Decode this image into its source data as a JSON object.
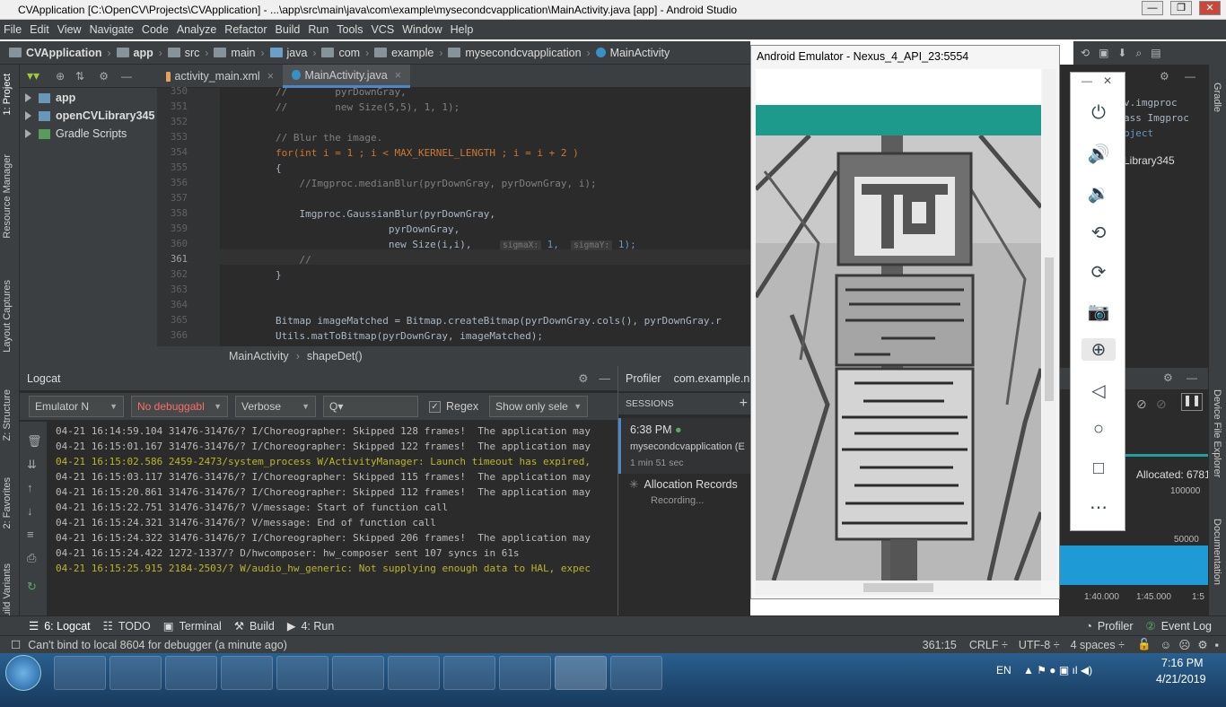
{
  "window": {
    "title": "CVApplication [C:\\OpenCV\\Projects\\CVApplication] - ...\\app\\src\\main\\java\\com\\example\\mysecondcvapplication\\MainActivity.java [app] - Android Studio",
    "min": "—",
    "max": "❐",
    "close": "✕"
  },
  "menu": [
    "File",
    "Edit",
    "View",
    "Navigate",
    "Code",
    "Analyze",
    "Refactor",
    "Build",
    "Run",
    "Tools",
    "VCS",
    "Window",
    "Help"
  ],
  "breadcrumb": [
    "CVApplication",
    "app",
    "src",
    "main",
    "java",
    "com",
    "example",
    "mysecondcvapplication",
    "MainActivity"
  ],
  "left_tabs": [
    "1: Project",
    "Resource Manager",
    "Layout Captures",
    "Z: Structure",
    "2: Favorites",
    "Build Variants"
  ],
  "project": {
    "items": [
      "app",
      "openCVLibrary345",
      "Gradle Scripts"
    ]
  },
  "editor": {
    "tabs": [
      "activity_main.xml",
      "MainActivity.java"
    ],
    "line_numbers": [
      "350",
      "351",
      "352",
      "353",
      "354",
      "355",
      "356",
      "357",
      "358",
      "359",
      "360",
      "361",
      "362",
      "363",
      "364",
      "365",
      "366"
    ],
    "lines": [
      "//        pyrDownGray,",
      "//        new Size(5,5), 1, 1);",
      "",
      "// Blur the image.",
      "for(int i = 1 ; i < MAX_KERNEL_LENGTH ; i = i + 2 )",
      "{",
      "    //Imgproc.medianBlur(pyrDownGray, pyrDownGray, i);",
      "",
      "    Imgproc.GaussianBlur(pyrDownGray,",
      "                   pyrDownGray,",
      "                   new Size(i,i),",
      "    //",
      "}",
      "",
      "",
      "Bitmap imageMatched = Bitmap.createBitmap(pyrDownGray.cols(), pyrDownGray.r",
      "Utils.matToBitmap(pyrDownGray, imageMatched);"
    ],
    "hint_sigmaX": "sigmaX:",
    "hint_sigmaX_val": "1,",
    "hint_sigmaY": "sigmaY:",
    "hint_sigmaY_val": "1);",
    "crumb": [
      "MainActivity",
      "shapeDet()"
    ]
  },
  "logcat": {
    "title": "Logcat",
    "device": "Emulator N",
    "process": "No debuggabl",
    "level": "Verbose",
    "search": "Q▾",
    "regex": "Regex",
    "show": "Show only sele",
    "lines": [
      "04-21 16:14:59.104 31476-31476/? I/Choreographer: Skipped 128 frames!  The application may",
      "04-21 16:15:01.167 31476-31476/? I/Choreographer: Skipped 122 frames!  The application may",
      "04-21 16:15:02.586 2459-2473/system_process W/ActivityManager: Launch timeout has expired,",
      "04-21 16:15:03.117 31476-31476/? I/Choreographer: Skipped 115 frames!  The application may",
      "04-21 16:15:20.861 31476-31476/? I/Choreographer: Skipped 112 frames!  The application may",
      "04-21 16:15:22.751 31476-31476/? V/message: Start of function call",
      "04-21 16:15:24.321 31476-31476/? V/message: End of function call",
      "04-21 16:15:24.322 31476-31476/? I/Choreographer: Skipped 206 frames!  The application may",
      "04-21 16:15:24.422 1272-1337/? D/hwcomposer: hw_composer sent 107 syncs in 61s",
      "04-21 16:15:25.915 2184-2503/? W/audio_hw_generic: Not supplying enough data to HAL, expec"
    ]
  },
  "profiler": {
    "title": "Profiler",
    "process": "com.example.n",
    "sessions": "SESSIONS",
    "time": "6:38 PM",
    "app": "mysecondcvapplication (E",
    "duration": "1 min 51 sec",
    "alloc": "Allocation Records",
    "recording": "Recording..."
  },
  "right": {
    "code1": "v.imgproc",
    "code2": "ass Imgproc",
    "code3": "bject",
    "lib": "Library345",
    "allocated": "Allocated: 6781",
    "v1": "100000",
    "v2": "50000",
    "t1": "1:40.000",
    "t2": "1:45.000",
    "t3": "1:5"
  },
  "right_tabs": [
    "Gradle",
    "Device File Explorer",
    "Documentation"
  ],
  "emulator": {
    "title": "Android Emulator - Nexus_4_API_23:5554"
  },
  "bottom_tools": [
    "6: Logcat",
    "TODO",
    "Terminal",
    "Build",
    "4: Run",
    "Profiler",
    "Event Log"
  ],
  "status": {
    "message": "Can't bind to local 8604 for debugger (a minute ago)",
    "pos": "361:15",
    "crlf": "CRLF ÷",
    "enc": "UTF-8 ÷",
    "indent": "4 spaces ÷"
  },
  "taskbar": {
    "lang": "EN",
    "time": "7:16 PM",
    "date": "4/21/2019"
  }
}
